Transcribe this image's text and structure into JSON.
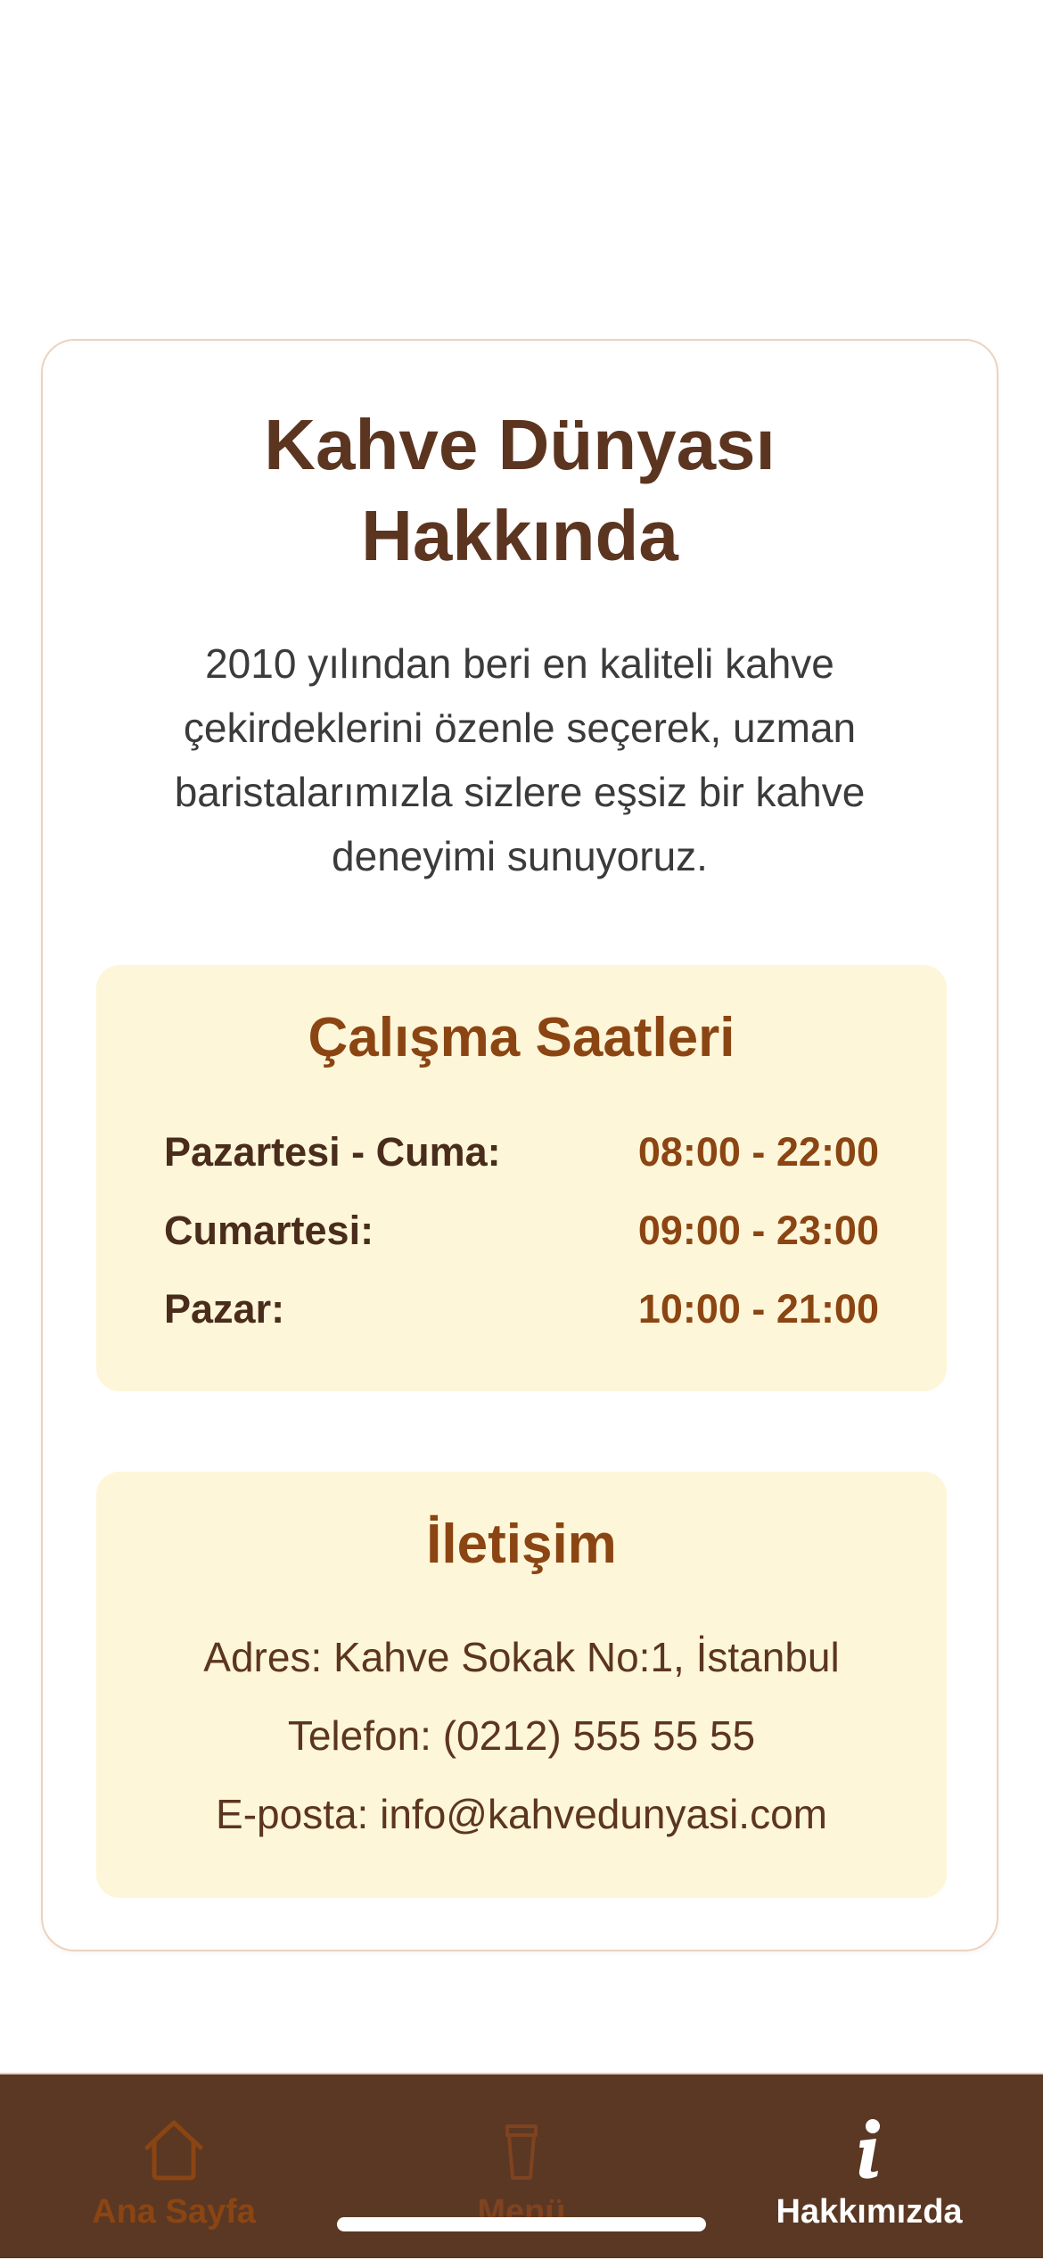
{
  "about": {
    "title_line1": "Kahve Dünyası",
    "title_line2": "Hakkında",
    "description": "2010 yılından beri en kaliteli kahve çekirdeklerini özenle seçerek, uzman baristalarımızla sizlere eşsiz bir kahve deneyimi sunuyoruz."
  },
  "hours": {
    "title": "Çalışma Saatleri",
    "rows": [
      {
        "day": "Pazartesi - Cuma:",
        "time": "08:00 - 22:00"
      },
      {
        "day": "Cumartesi:",
        "time": "09:00 - 23:00"
      },
      {
        "day": "Pazar:",
        "time": "10:00 - 21:00"
      }
    ]
  },
  "contact": {
    "title": "İletişim",
    "address": "Adres: Kahve Sokak No:1, İstanbul",
    "phone": "Telefon: (0212) 555 55 55",
    "email": "E-posta: info@kahvedunyasi.com"
  },
  "tabbar": {
    "items": [
      {
        "label": "Ana Sayfa",
        "icon": "home-icon",
        "active": false
      },
      {
        "label": "Menü",
        "icon": "cup-icon",
        "active": false
      },
      {
        "label": "Hakkımızda",
        "icon": "info-icon",
        "active": true
      }
    ]
  },
  "colors": {
    "primary": "#8b4513",
    "dark_brown": "#5c3520",
    "tabbar_bg": "#5b3823",
    "box_bg": "#fef6d9",
    "card_border": "#ecd2c0"
  }
}
